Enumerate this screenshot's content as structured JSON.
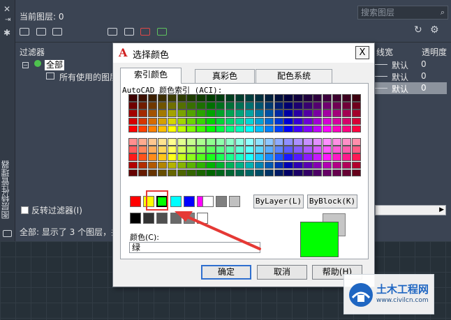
{
  "layer_manager": {
    "current_layer": "当前图层: 0",
    "search_placeholder": "搜索图层",
    "filters_header": "过滤器",
    "tree": {
      "all": "全部",
      "used": "所有使用的图层"
    },
    "columns": {
      "lineweight": "线宽",
      "transparency": "透明度"
    },
    "rows": [
      {
        "lineweight": "默认",
        "transparency": "0"
      },
      {
        "lineweight": "默认",
        "transparency": "0"
      },
      {
        "lineweight": "默认",
        "transparency": "0"
      }
    ],
    "invert_filter": "反转过滤器(I)",
    "status": "全部: 显示了 3 个图层，共",
    "side_title": "图层特性管理器"
  },
  "dialog": {
    "title": "选择颜色",
    "close": "X",
    "tabs": [
      "索引颜色",
      "真彩色",
      "配色系统"
    ],
    "aci_label": "AutoCAD 颜色索引 (ACI):",
    "bylayer": "ByLayer(L)",
    "byblock": "ByBlock(K)",
    "color_label": "颜色(C):",
    "color_value": "绿",
    "buttons": {
      "ok": "确定",
      "cancel": "取消",
      "help": "帮助(H)"
    },
    "standard_colors": [
      "#ff0000",
      "#ffff00",
      "#00ff00",
      "#00ffff",
      "#0000ff",
      "#ff00ff",
      "#ffffff",
      "#808080",
      "#c0c0c0"
    ],
    "gray_colors": [
      "#000000",
      "#333333",
      "#505050",
      "#696969",
      "#808080",
      "#ffffff"
    ],
    "selected_color": "#00ff00",
    "previous_color": "#c6c6c6"
  },
  "watermark": {
    "title": "土木工程网",
    "url": "www.civilcn.com"
  }
}
